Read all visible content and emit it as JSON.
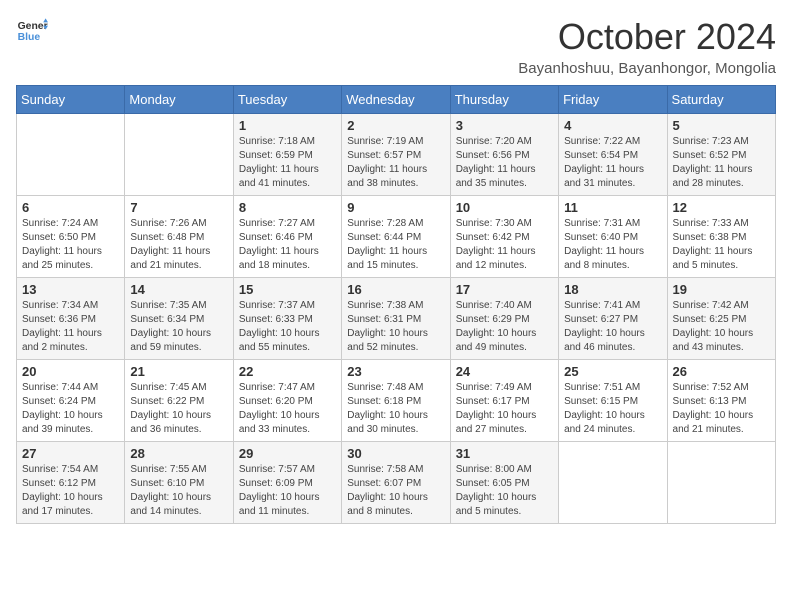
{
  "logo": {
    "line1": "General",
    "line2": "Blue"
  },
  "title": "October 2024",
  "location": "Bayanhoshuu, Bayanhongor, Mongolia",
  "weekdays": [
    "Sunday",
    "Monday",
    "Tuesday",
    "Wednesday",
    "Thursday",
    "Friday",
    "Saturday"
  ],
  "weeks": [
    [
      null,
      null,
      {
        "day": 1,
        "sunrise": "7:18 AM",
        "sunset": "6:59 PM",
        "daylight": "11 hours and 41 minutes."
      },
      {
        "day": 2,
        "sunrise": "7:19 AM",
        "sunset": "6:57 PM",
        "daylight": "11 hours and 38 minutes."
      },
      {
        "day": 3,
        "sunrise": "7:20 AM",
        "sunset": "6:56 PM",
        "daylight": "11 hours and 35 minutes."
      },
      {
        "day": 4,
        "sunrise": "7:22 AM",
        "sunset": "6:54 PM",
        "daylight": "11 hours and 31 minutes."
      },
      {
        "day": 5,
        "sunrise": "7:23 AM",
        "sunset": "6:52 PM",
        "daylight": "11 hours and 28 minutes."
      }
    ],
    [
      {
        "day": 6,
        "sunrise": "7:24 AM",
        "sunset": "6:50 PM",
        "daylight": "11 hours and 25 minutes."
      },
      {
        "day": 7,
        "sunrise": "7:26 AM",
        "sunset": "6:48 PM",
        "daylight": "11 hours and 21 minutes."
      },
      {
        "day": 8,
        "sunrise": "7:27 AM",
        "sunset": "6:46 PM",
        "daylight": "11 hours and 18 minutes."
      },
      {
        "day": 9,
        "sunrise": "7:28 AM",
        "sunset": "6:44 PM",
        "daylight": "11 hours and 15 minutes."
      },
      {
        "day": 10,
        "sunrise": "7:30 AM",
        "sunset": "6:42 PM",
        "daylight": "11 hours and 12 minutes."
      },
      {
        "day": 11,
        "sunrise": "7:31 AM",
        "sunset": "6:40 PM",
        "daylight": "11 hours and 8 minutes."
      },
      {
        "day": 12,
        "sunrise": "7:33 AM",
        "sunset": "6:38 PM",
        "daylight": "11 hours and 5 minutes."
      }
    ],
    [
      {
        "day": 13,
        "sunrise": "7:34 AM",
        "sunset": "6:36 PM",
        "daylight": "11 hours and 2 minutes."
      },
      {
        "day": 14,
        "sunrise": "7:35 AM",
        "sunset": "6:34 PM",
        "daylight": "10 hours and 59 minutes."
      },
      {
        "day": 15,
        "sunrise": "7:37 AM",
        "sunset": "6:33 PM",
        "daylight": "10 hours and 55 minutes."
      },
      {
        "day": 16,
        "sunrise": "7:38 AM",
        "sunset": "6:31 PM",
        "daylight": "10 hours and 52 minutes."
      },
      {
        "day": 17,
        "sunrise": "7:40 AM",
        "sunset": "6:29 PM",
        "daylight": "10 hours and 49 minutes."
      },
      {
        "day": 18,
        "sunrise": "7:41 AM",
        "sunset": "6:27 PM",
        "daylight": "10 hours and 46 minutes."
      },
      {
        "day": 19,
        "sunrise": "7:42 AM",
        "sunset": "6:25 PM",
        "daylight": "10 hours and 43 minutes."
      }
    ],
    [
      {
        "day": 20,
        "sunrise": "7:44 AM",
        "sunset": "6:24 PM",
        "daylight": "10 hours and 39 minutes."
      },
      {
        "day": 21,
        "sunrise": "7:45 AM",
        "sunset": "6:22 PM",
        "daylight": "10 hours and 36 minutes."
      },
      {
        "day": 22,
        "sunrise": "7:47 AM",
        "sunset": "6:20 PM",
        "daylight": "10 hours and 33 minutes."
      },
      {
        "day": 23,
        "sunrise": "7:48 AM",
        "sunset": "6:18 PM",
        "daylight": "10 hours and 30 minutes."
      },
      {
        "day": 24,
        "sunrise": "7:49 AM",
        "sunset": "6:17 PM",
        "daylight": "10 hours and 27 minutes."
      },
      {
        "day": 25,
        "sunrise": "7:51 AM",
        "sunset": "6:15 PM",
        "daylight": "10 hours and 24 minutes."
      },
      {
        "day": 26,
        "sunrise": "7:52 AM",
        "sunset": "6:13 PM",
        "daylight": "10 hours and 21 minutes."
      }
    ],
    [
      {
        "day": 27,
        "sunrise": "7:54 AM",
        "sunset": "6:12 PM",
        "daylight": "10 hours and 17 minutes."
      },
      {
        "day": 28,
        "sunrise": "7:55 AM",
        "sunset": "6:10 PM",
        "daylight": "10 hours and 14 minutes."
      },
      {
        "day": 29,
        "sunrise": "7:57 AM",
        "sunset": "6:09 PM",
        "daylight": "10 hours and 11 minutes."
      },
      {
        "day": 30,
        "sunrise": "7:58 AM",
        "sunset": "6:07 PM",
        "daylight": "10 hours and 8 minutes."
      },
      {
        "day": 31,
        "sunrise": "8:00 AM",
        "sunset": "6:05 PM",
        "daylight": "10 hours and 5 minutes."
      },
      null,
      null
    ]
  ],
  "labels": {
    "sunrise": "Sunrise:",
    "sunset": "Sunset:",
    "daylight": "Daylight:"
  }
}
